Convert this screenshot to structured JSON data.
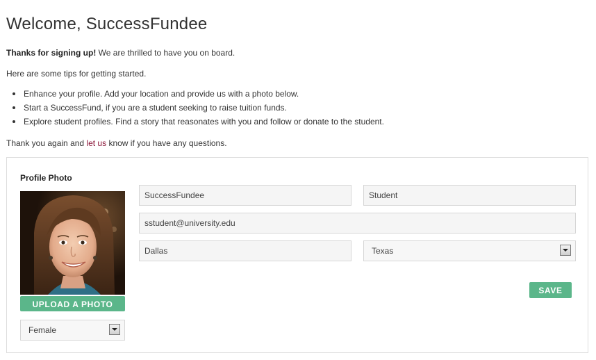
{
  "page": {
    "title": "Welcome, SuccessFundee"
  },
  "intro": {
    "thanks_bold": "Thanks for signing up!",
    "thanks_rest": " We are thrilled to have you on board.",
    "tips_heading": "Here are some tips for getting started.",
    "tips": [
      "Enhance your profile. Add your location and provide us with a photo below.",
      "Start a SuccessFund, if you are a student seeking to raise tuition funds.",
      "Explore student profiles. Find a story that reasonates with you and follow or donate to the student."
    ],
    "closing_before": "Thank you again and ",
    "closing_link": "let us",
    "closing_after": " know if you have any questions."
  },
  "profile": {
    "photo_heading": "Profile Photo",
    "upload_label": "UPLOAD A PHOTO",
    "gender": "Female",
    "first_name": "SuccessFundee",
    "last_name": "Student",
    "email": "sstudent@university.edu",
    "city": "Dallas",
    "state": "Texas",
    "save_label": "SAVE"
  },
  "colors": {
    "accent_button": "#5bb68a",
    "link": "#8a1538"
  }
}
